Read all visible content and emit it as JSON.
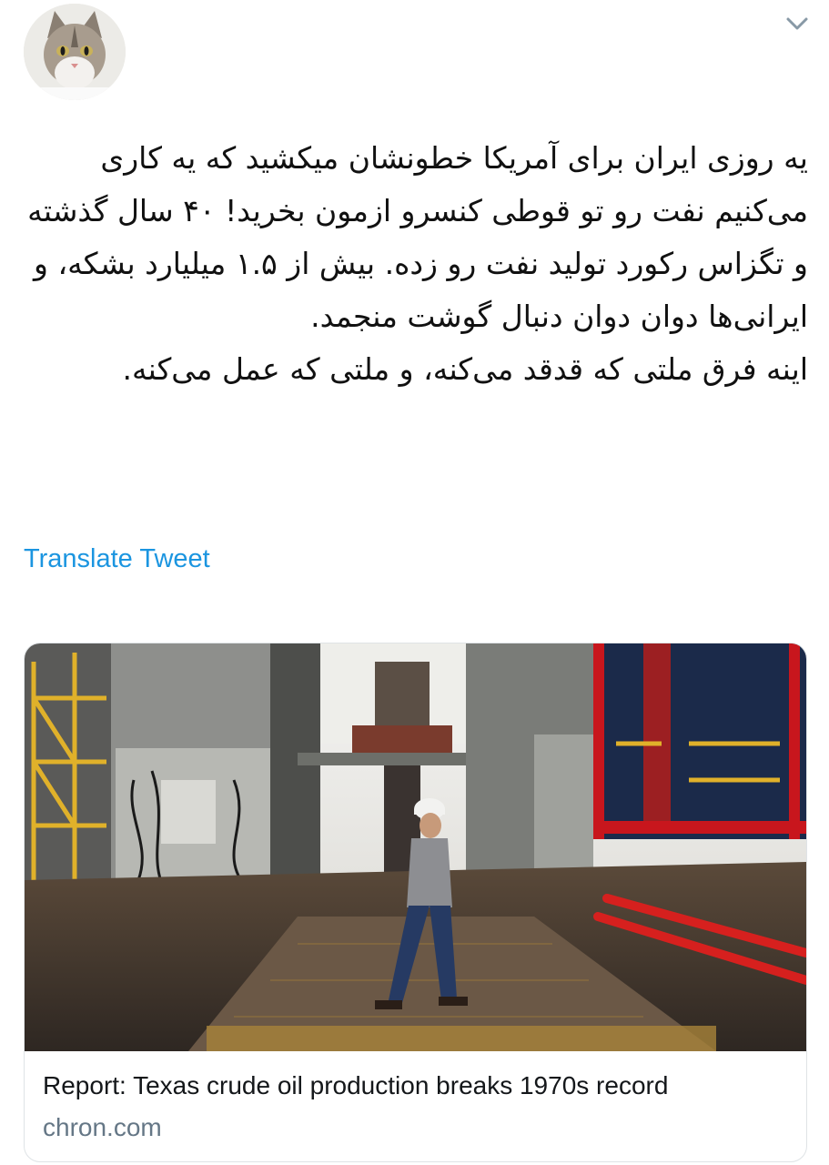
{
  "tweet": {
    "avatar_icon": "cat-avatar-icon",
    "menu_icon": "chevron-down-icon",
    "text_lines": [
      "یه روزی ایران برای آمریکا خطونشان میکشید که یه کاری می‌کنیم نفت رو تو قوطی کنسرو ازمون بخرید! ۴۰ سال گذشته و تگزاس رکورد تولید نفت رو زده. بیش از ۱.۵ میلیارد بشکه، و ایرانی‌ها دوان دوان دنبال گوشت منجمد.",
      "اینه فرق ملتی که قدقد می‌کنه، و ملتی که عمل می‌کنه."
    ],
    "translate_label": "Translate Tweet"
  },
  "card": {
    "title": "Report: Texas crude oil production breaks 1970s record",
    "domain": "chron.com",
    "colors": {
      "red_structure": "#c8161d",
      "yellow_rail": "#e0b12a",
      "link_blue": "#1b95e0",
      "domain_gray": "#657786"
    }
  }
}
